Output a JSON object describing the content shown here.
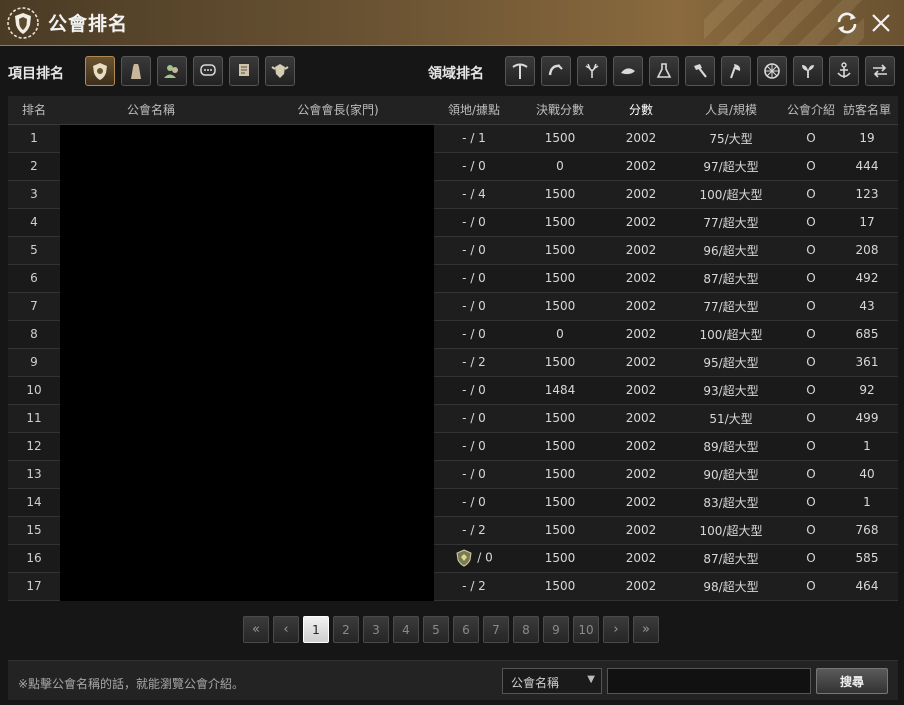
{
  "window": {
    "title": "公會排名"
  },
  "toolbar": {
    "category_label": "項目排名",
    "domain_label": "領域排名",
    "category_icons": [
      "guild-crest-icon",
      "robe-icon",
      "members-icon",
      "chat-icon",
      "scroll-icon",
      "battle-crest-icon"
    ],
    "domain_icons": [
      "pickaxe-icon",
      "hoe-icon",
      "deer-icon",
      "gathering-icon",
      "alchemy-flask-icon",
      "hammer-icon",
      "axe-icon",
      "wheel-icon",
      "sprout-icon",
      "anchor-icon",
      "trade-arrows-icon"
    ],
    "active_category": 0
  },
  "table": {
    "headers": [
      "排名",
      "公會名稱",
      "公會會長(家門)",
      "領地/據點",
      "決戰分數",
      "分數",
      "人員/規模",
      "公會介紹",
      "訪客名單"
    ],
    "highlight_header": 5,
    "rows": [
      {
        "rank": "1",
        "territory": "- / 1",
        "battle": "1500",
        "score": "2002",
        "members": "75/大型",
        "intro": "O",
        "visitors": "19"
      },
      {
        "rank": "2",
        "territory": "- / 0",
        "battle": "0",
        "score": "2002",
        "members": "97/超大型",
        "intro": "O",
        "visitors": "444"
      },
      {
        "rank": "3",
        "territory": "- / 4",
        "battle": "1500",
        "score": "2002",
        "members": "100/超大型",
        "intro": "O",
        "visitors": "123"
      },
      {
        "rank": "4",
        "territory": "- / 0",
        "battle": "1500",
        "score": "2002",
        "members": "77/超大型",
        "intro": "O",
        "visitors": "17"
      },
      {
        "rank": "5",
        "territory": "- / 0",
        "battle": "1500",
        "score": "2002",
        "members": "96/超大型",
        "intro": "O",
        "visitors": "208"
      },
      {
        "rank": "6",
        "territory": "- / 0",
        "battle": "1500",
        "score": "2002",
        "members": "87/超大型",
        "intro": "O",
        "visitors": "492"
      },
      {
        "rank": "7",
        "territory": "- / 0",
        "battle": "1500",
        "score": "2002",
        "members": "77/超大型",
        "intro": "O",
        "visitors": "43"
      },
      {
        "rank": "8",
        "territory": "- / 0",
        "battle": "0",
        "score": "2002",
        "members": "100/超大型",
        "intro": "O",
        "visitors": "685"
      },
      {
        "rank": "9",
        "territory": "- / 2",
        "battle": "1500",
        "score": "2002",
        "members": "95/超大型",
        "intro": "O",
        "visitors": "361"
      },
      {
        "rank": "10",
        "territory": "- / 0",
        "battle": "1484",
        "score": "2002",
        "members": "93/超大型",
        "intro": "O",
        "visitors": "92"
      },
      {
        "rank": "11",
        "territory": "- / 0",
        "battle": "1500",
        "score": "2002",
        "members": "51/大型",
        "intro": "O",
        "visitors": "499"
      },
      {
        "rank": "12",
        "territory": "- / 0",
        "battle": "1500",
        "score": "2002",
        "members": "89/超大型",
        "intro": "O",
        "visitors": "1"
      },
      {
        "rank": "13",
        "territory": "- / 0",
        "battle": "1500",
        "score": "2002",
        "members": "90/超大型",
        "intro": "O",
        "visitors": "40"
      },
      {
        "rank": "14",
        "territory": "- / 0",
        "battle": "1500",
        "score": "2002",
        "members": "83/超大型",
        "intro": "O",
        "visitors": "1"
      },
      {
        "rank": "15",
        "territory": "- / 2",
        "battle": "1500",
        "score": "2002",
        "members": "100/超大型",
        "intro": "O",
        "visitors": "768"
      },
      {
        "rank": "16",
        "territory": "/ 0",
        "battle": "1500",
        "score": "2002",
        "members": "87/超大型",
        "intro": "O",
        "visitors": "585",
        "emblem": true
      },
      {
        "rank": "17",
        "territory": "- / 2",
        "battle": "1500",
        "score": "2002",
        "members": "98/超大型",
        "intro": "O",
        "visitors": "464"
      }
    ]
  },
  "pager": {
    "pages": [
      "1",
      "2",
      "3",
      "4",
      "5",
      "6",
      "7",
      "8",
      "9",
      "10"
    ],
    "current": "1",
    "first": "«",
    "prev": "‹",
    "next": "›",
    "last": "»"
  },
  "footer": {
    "hint": "※點擊公會名稱的話，就能瀏覽公會介紹。",
    "search_type": "公會名稱",
    "search_value": "",
    "search_button": "搜尋"
  },
  "colors": {
    "accent": "#b08a50",
    "title_bg": "#6d5534"
  }
}
